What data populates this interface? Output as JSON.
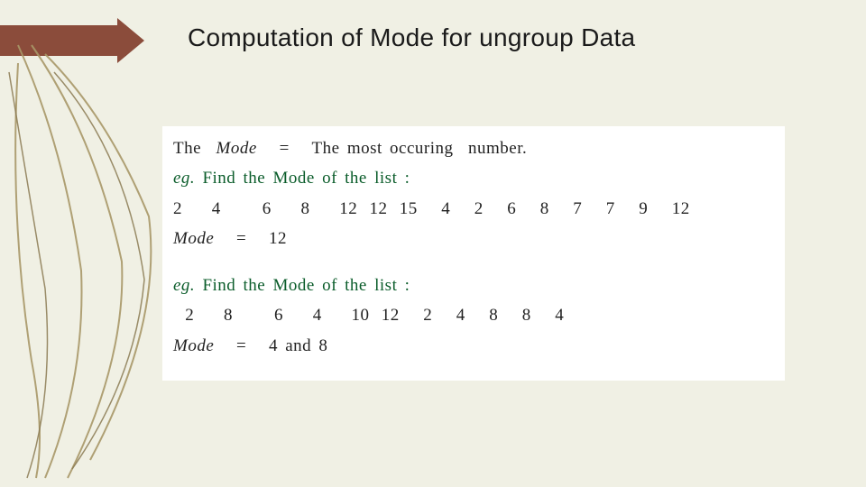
{
  "title": "Computation of Mode for ungroup Data",
  "definition": {
    "prefix": "The",
    "term_italic": "Mode",
    "equals": "=",
    "suffix": "The most occuring  number."
  },
  "example1": {
    "eg_prefix_italic": "eg.",
    "prompt_rest": " Find the Mode of the list :",
    "numbers": "2  4   6  8  12 12 15  4  2  6  8  7  7  9  12",
    "result_label_italic": "Mode",
    "result_equals": "=",
    "result_value": "12"
  },
  "example2": {
    "eg_prefix_italic": "eg.",
    "prompt_rest": " Find the Mode of the list :",
    "numbers": " 2  8   6  4  10 12  2  4  8  8  4",
    "result_label_italic": "Mode",
    "result_equals": "=",
    "result_value": "4 and 8"
  }
}
